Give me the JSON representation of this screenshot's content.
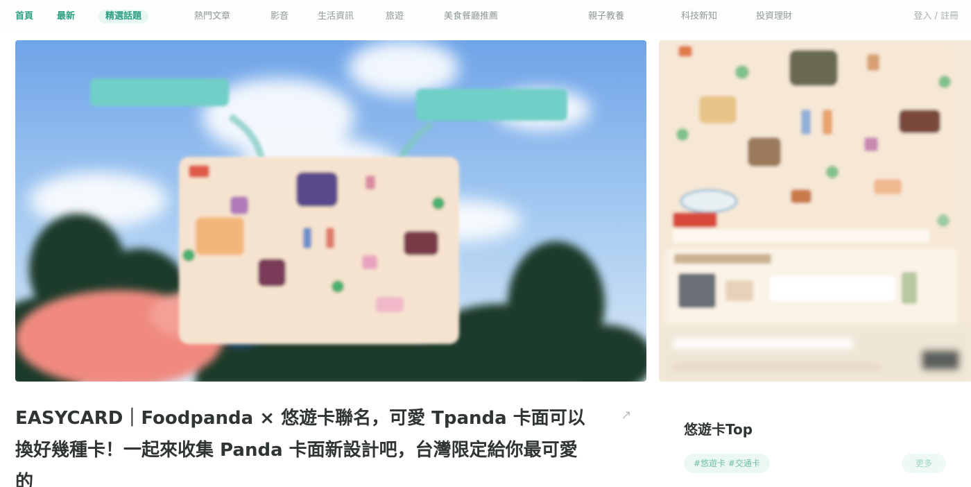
{
  "nav": {
    "home": "首頁",
    "latest": "最新",
    "featured": "精選話題",
    "items": [
      "熱門文章",
      "影音",
      "生活資訊",
      "旅遊",
      "美食餐廳推薦",
      "親子教養",
      "科技新知",
      "投資理財"
    ],
    "right": "登入 / 註冊"
  },
  "hero": {
    "alt": "悠遊卡"
  },
  "article": {
    "title": "EASYCARD｜Foodpanda × 悠遊卡聯名，可愛 Tpanda 卡面可以換好幾種卡！一起來收集 Panda 卡面新設計吧，台灣限定給你最可愛的",
    "action_icon": "share-icon"
  },
  "sidebar": {
    "title": "悠遊卡Top",
    "tag": "#悠遊卡 #交通卡",
    "more": "更多"
  },
  "colors": {
    "accent": "#2f9f83",
    "sky": "#8fbcef",
    "card": "#f5ead9"
  }
}
